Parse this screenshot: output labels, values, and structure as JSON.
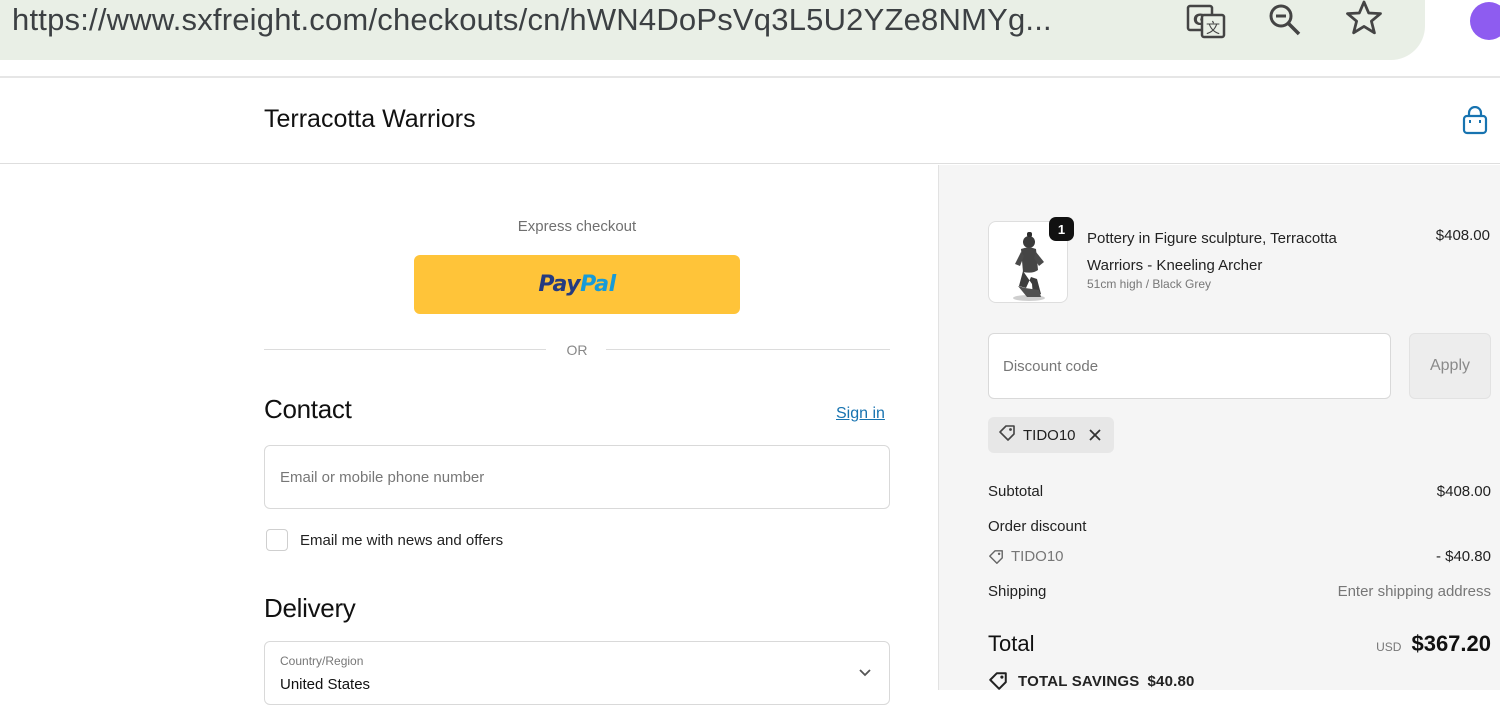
{
  "browser": {
    "url": "https://www.sxfreight.com/checkouts/cn/hWN4DoPsVq3L5U2YZe8NMYg..."
  },
  "header": {
    "store_name": "Terracotta Warriors"
  },
  "express": {
    "label": "Express checkout",
    "paypal_part1": "Pay",
    "paypal_part2": "Pal",
    "or_text": "OR"
  },
  "contact": {
    "title": "Contact",
    "signin_label": "Sign in",
    "email_placeholder": "Email or mobile phone number",
    "newsletter_label": "Email me with news and offers"
  },
  "delivery": {
    "title": "Delivery",
    "country_label": "Country/Region",
    "country_value": "United States"
  },
  "summary": {
    "product": {
      "quantity": "1",
      "title": "Pottery in Figure sculpture, Terracotta Warriors - Kneeling Archer",
      "variant": "51cm high / Black Grey",
      "price": "$408.00"
    },
    "discount_placeholder": "Discount code",
    "apply_label": "Apply",
    "applied_code": "TIDO10",
    "subtotal_label": "Subtotal",
    "subtotal_value": "$408.00",
    "order_discount_label": "Order discount",
    "discount_code": "TIDO10",
    "discount_value": "- $40.80",
    "shipping_label": "Shipping",
    "shipping_value": "Enter shipping address",
    "total_label": "Total",
    "total_currency": "USD",
    "total_value": "$367.20",
    "savings_label": "TOTAL SAVINGS",
    "savings_value": "$40.80"
  },
  "colors": {
    "paypal_yellow": "#ffc439",
    "link_blue": "#1773b0",
    "summary_bg": "#f5f5f5"
  }
}
